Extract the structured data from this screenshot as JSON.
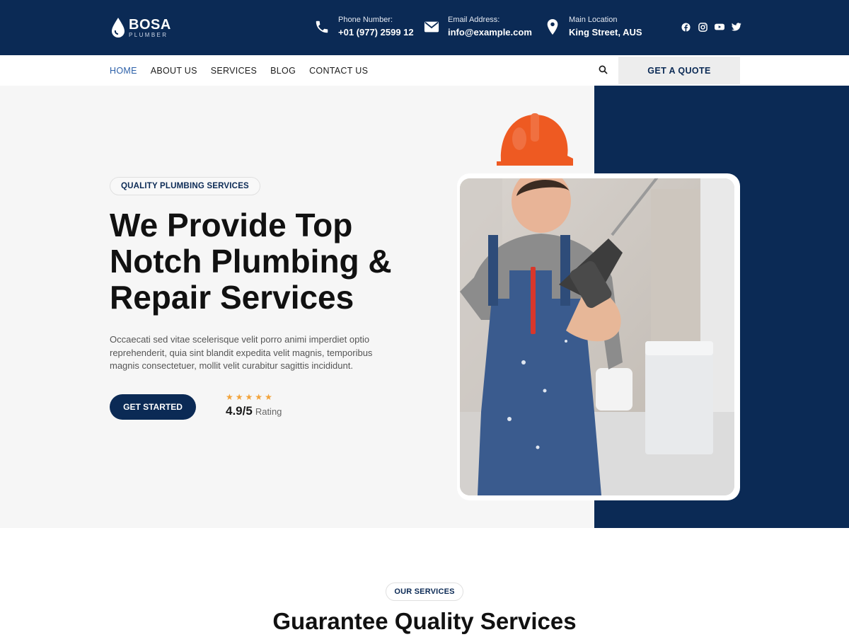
{
  "brand": {
    "name": "BOSA",
    "tagline": "PLUMBER"
  },
  "contact": {
    "phone": {
      "label": "Phone Number:",
      "value": "+01 (977) 2599 12"
    },
    "email": {
      "label": "Email Address:",
      "value": "info@example.com"
    },
    "location": {
      "label": "Main Location",
      "value": "King Street, AUS"
    }
  },
  "socials": [
    "facebook-icon",
    "instagram-icon",
    "youtube-icon",
    "twitter-icon"
  ],
  "nav": {
    "items": [
      {
        "label": "HOME",
        "active": true
      },
      {
        "label": "ABOUT US",
        "active": false
      },
      {
        "label": "SERVICES",
        "active": false
      },
      {
        "label": "BLOG",
        "active": false
      },
      {
        "label": "CONTACT US",
        "active": false
      }
    ],
    "cta_label": "GET A QUOTE"
  },
  "hero": {
    "badge": "QUALITY PLUMBING SERVICES",
    "headline": "We Provide Top Notch Plumbing & Repair Services",
    "text": "Occaecati sed vitae scelerisque velit porro animi imperdiet optio reprehenderit, quia sint blandit expedita velit magnis, temporibus magnis consectetuer, mollit velit curabitur sagittis incididunt.",
    "cta_label": "GET STARTED",
    "rating_value": "4.9",
    "rating_scale": "/5",
    "rating_label": "Rating",
    "stars": 5
  },
  "services": {
    "badge": "OUR SERVICES",
    "title": "Guarantee Quality Services"
  },
  "colors": {
    "navy": "#0b2a55",
    "accent_blue": "#2b5fa8",
    "star": "#f2a33a",
    "hero_bg": "#f6f6f6"
  }
}
